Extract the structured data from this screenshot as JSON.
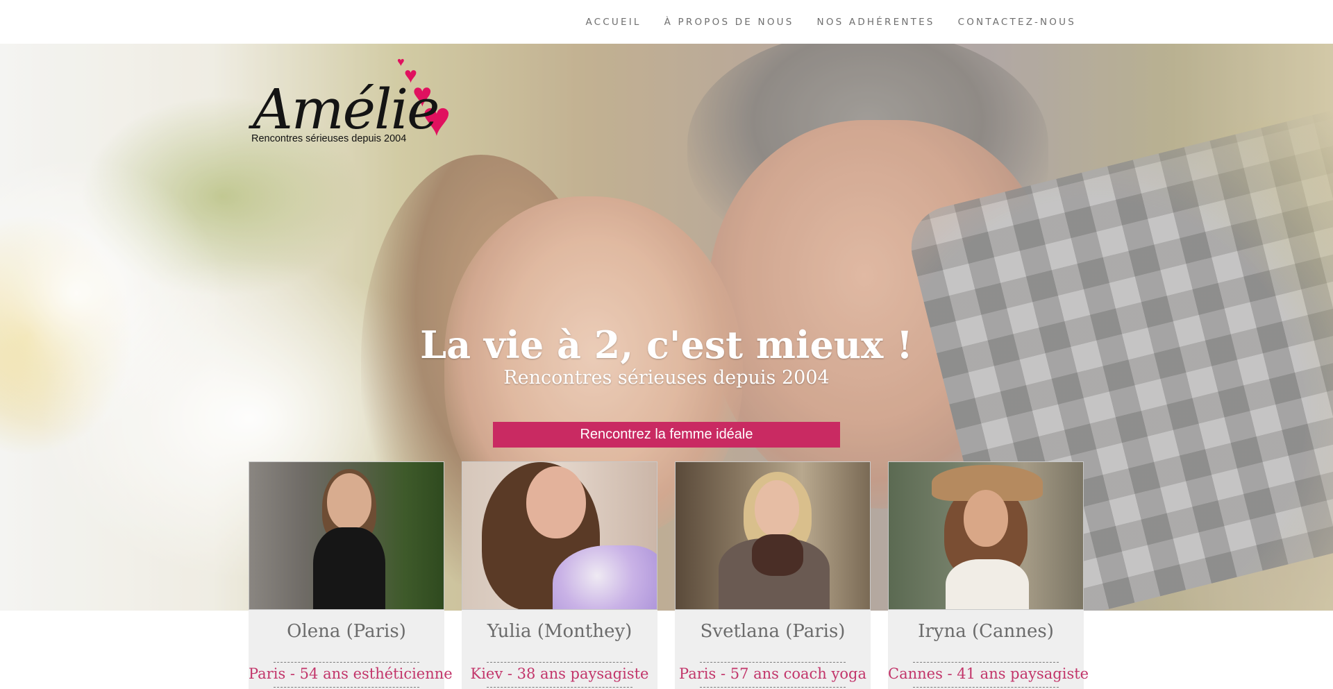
{
  "nav": {
    "items": [
      "ACCUEIL",
      "À PROPOS DE NOUS",
      "NOS ADHÉRENTES",
      "CONTACTEZ-NOUS"
    ]
  },
  "logo": {
    "wordmark": "Amélie",
    "tagline": "Rencontres sérieuses depuis 2004",
    "accent_color": "#e0115f"
  },
  "hero": {
    "headline": "La vie à 2, c'est mieux !",
    "subheadline": "Rencontres sérieuses depuis 2004",
    "cta_label": "Rencontrez la femme idéale",
    "cta_color": "#c92a62"
  },
  "members": [
    {
      "name": "Olena (Paris)",
      "info": "Paris - 54 ans esthéticienne"
    },
    {
      "name": "Yulia (Monthey)",
      "info": "Kiev - 38 ans paysagiste"
    },
    {
      "name": "Svetlana (Paris)",
      "info": "Paris - 57 ans coach yoga"
    },
    {
      "name": "Iryna (Cannes)",
      "info": "Cannes - 41 ans paysagiste"
    }
  ]
}
